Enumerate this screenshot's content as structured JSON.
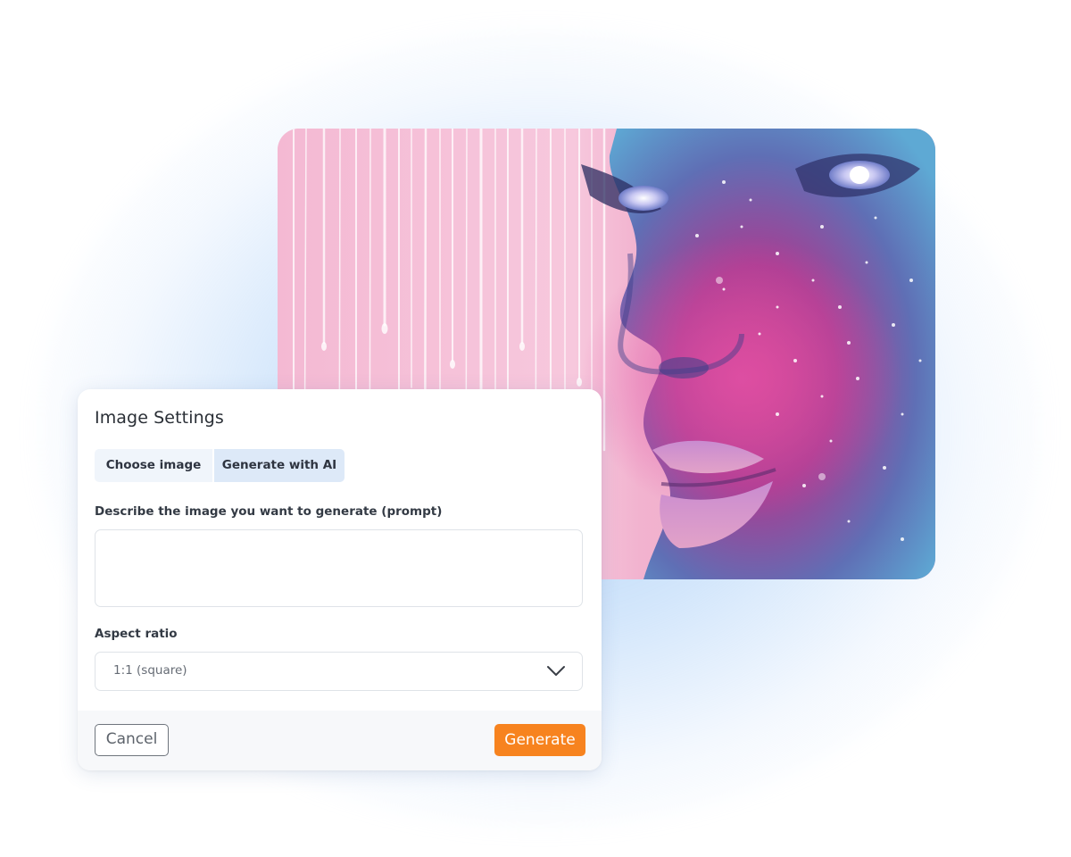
{
  "dialog": {
    "title": "Image Settings",
    "tabs": [
      {
        "label": "Choose image",
        "active": false
      },
      {
        "label": "Generate with AI",
        "active": true
      }
    ],
    "prompt": {
      "label": "Describe the image you want to generate (prompt)",
      "value": "",
      "placeholder": ""
    },
    "aspect_ratio": {
      "label": "Aspect ratio",
      "selected": "1:1 (square)"
    },
    "buttons": {
      "cancel": "Cancel",
      "generate": "Generate"
    }
  },
  "colors": {
    "accent": "#f7831f",
    "active_tab": "#dde9f8",
    "inactive_tab": "#f0f5fb",
    "glow": "#a9cdf5"
  },
  "icons": {
    "select_indicator": "chevron-down-icon"
  }
}
